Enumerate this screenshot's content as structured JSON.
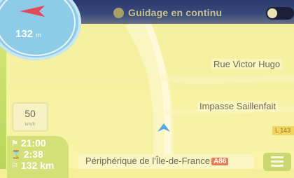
{
  "topbar": {
    "title": "Guidage en continu",
    "icon": "car-icon",
    "toggle_state": "on"
  },
  "compass": {
    "distance": "132",
    "unit": "m",
    "arrow_color": "#e24a5a"
  },
  "streets": [
    {
      "name": "Rue Victor Hugo"
    },
    {
      "name": "Impasse Saillenfait"
    }
  ],
  "road_badge": "L 143",
  "speed_limit": {
    "value": "50",
    "unit": "km/h"
  },
  "trip_info": {
    "arrival_time": "21:00",
    "remaining_time": "2:38",
    "remaining_distance": "132 km"
  },
  "current_road": {
    "name": "Périphérique de l'Île-de-France",
    "shield": "A86",
    "shield_color": "#e77c52"
  },
  "colors": {
    "map_background": "#f5ef9a",
    "panel_green": "#d2e077",
    "topbar": "#2a3a6e"
  }
}
